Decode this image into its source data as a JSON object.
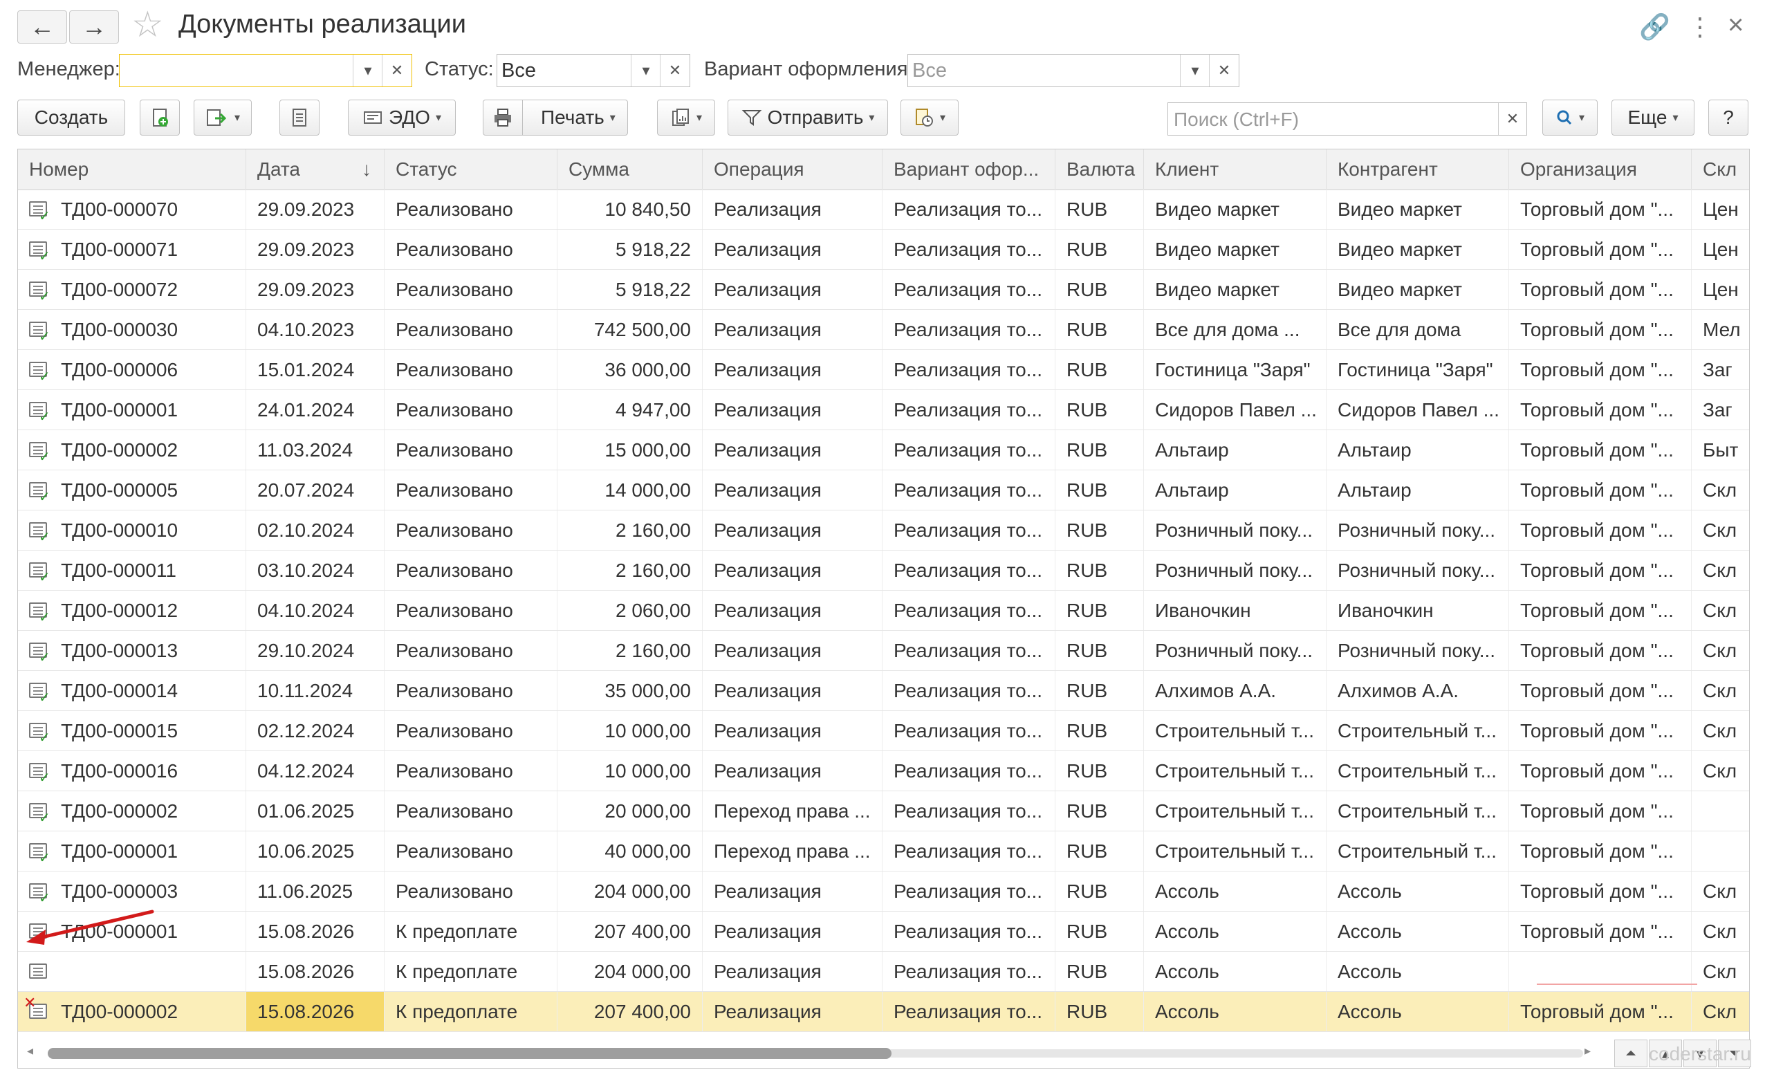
{
  "window": {
    "title": "Документы реализации",
    "back_icon": "←",
    "forward_icon": "→",
    "star_icon": "☆",
    "link_icon": "🔗",
    "menu_icon": "⋮",
    "close_icon": "×"
  },
  "filters": {
    "manager_label": "Менеджер:",
    "manager_value": "",
    "status_label": "Статус:",
    "status_value": "Все",
    "variant_label": "Вариант оформления:",
    "variant_value": "Все"
  },
  "toolbar": {
    "create": "Создать",
    "edo": "ЭДО",
    "print": "Печать",
    "send": "Отправить",
    "search_placeholder": "Поиск (Ctrl+F)",
    "more": "Еще",
    "help": "?"
  },
  "table": {
    "columns": [
      "Номер",
      "Дата",
      "Статус",
      "Сумма",
      "Операция",
      "Вариант офор...",
      "Валюта",
      "Клиент",
      "Контрагент",
      "Организация",
      "Скл"
    ],
    "sort_indicator": "↓",
    "rows": [
      {
        "icon": "posted",
        "number": "ТД00-000070",
        "date": "29.09.2023",
        "status": "Реализовано",
        "sum": "10 840,50",
        "operation": "Реализация",
        "variant": "Реализация то...",
        "currency": "RUB",
        "client": "Видео маркет",
        "counterparty": "Видео маркет",
        "org": "Торговый дом \"...",
        "wh": "Цен"
      },
      {
        "icon": "posted",
        "number": "ТД00-000071",
        "date": "29.09.2023",
        "status": "Реализовано",
        "sum": "5 918,22",
        "operation": "Реализация",
        "variant": "Реализация то...",
        "currency": "RUB",
        "client": "Видео маркет",
        "counterparty": "Видео маркет",
        "org": "Торговый дом \"...",
        "wh": "Цен"
      },
      {
        "icon": "posted",
        "number": "ТД00-000072",
        "date": "29.09.2023",
        "status": "Реализовано",
        "sum": "5 918,22",
        "operation": "Реализация",
        "variant": "Реализация то...",
        "currency": "RUB",
        "client": "Видео маркет",
        "counterparty": "Видео маркет",
        "org": "Торговый дом \"...",
        "wh": "Цен"
      },
      {
        "icon": "posted",
        "number": "ТД00-000030",
        "date": "04.10.2023",
        "status": "Реализовано",
        "sum": "742 500,00",
        "operation": "Реализация",
        "variant": "Реализация то...",
        "currency": "RUB",
        "client": "Все для дома ...",
        "counterparty": "Все для дома",
        "org": "Торговый дом \"...",
        "wh": "Мел"
      },
      {
        "icon": "posted",
        "number": "ТД00-000006",
        "date": "15.01.2024",
        "status": "Реализовано",
        "sum": "36 000,00",
        "operation": "Реализация",
        "variant": "Реализация то...",
        "currency": "RUB",
        "client": "Гостиница \"Заря\"",
        "counterparty": "Гостиница \"Заря\"",
        "org": "Торговый дом \"...",
        "wh": "Заг"
      },
      {
        "icon": "posted",
        "number": "ТД00-000001",
        "date": "24.01.2024",
        "status": "Реализовано",
        "sum": "4 947,00",
        "operation": "Реализация",
        "variant": "Реализация то...",
        "currency": "RUB",
        "client": "Сидоров Павел ...",
        "counterparty": "Сидоров Павел ...",
        "org": "Торговый дом \"...",
        "wh": "Заг"
      },
      {
        "icon": "posted",
        "number": "ТД00-000002",
        "date": "11.03.2024",
        "status": "Реализовано",
        "sum": "15 000,00",
        "operation": "Реализация",
        "variant": "Реализация то...",
        "currency": "RUB",
        "client": "Альтаир",
        "counterparty": "Альтаир",
        "org": "Торговый дом \"...",
        "wh": "Быт"
      },
      {
        "icon": "posted",
        "number": "ТД00-000005",
        "date": "20.07.2024",
        "status": "Реализовано",
        "sum": "14 000,00",
        "operation": "Реализация",
        "variant": "Реализация то...",
        "currency": "RUB",
        "client": "Альтаир",
        "counterparty": "Альтаир",
        "org": "Торговый дом \"...",
        "wh": "Скл"
      },
      {
        "icon": "posted",
        "number": "ТД00-000010",
        "date": "02.10.2024",
        "status": "Реализовано",
        "sum": "2 160,00",
        "operation": "Реализация",
        "variant": "Реализация то...",
        "currency": "RUB",
        "client": "Розничный поку...",
        "counterparty": "Розничный поку...",
        "org": "Торговый дом \"...",
        "wh": "Скл"
      },
      {
        "icon": "posted",
        "number": "ТД00-000011",
        "date": "03.10.2024",
        "status": "Реализовано",
        "sum": "2 160,00",
        "operation": "Реализация",
        "variant": "Реализация то...",
        "currency": "RUB",
        "client": "Розничный поку...",
        "counterparty": "Розничный поку...",
        "org": "Торговый дом \"...",
        "wh": "Скл"
      },
      {
        "icon": "posted",
        "number": "ТД00-000012",
        "date": "04.10.2024",
        "status": "Реализовано",
        "sum": "2 060,00",
        "operation": "Реализация",
        "variant": "Реализация то...",
        "currency": "RUB",
        "client": "Иваночкин",
        "counterparty": "Иваночкин",
        "org": "Торговый дом \"...",
        "wh": "Скл"
      },
      {
        "icon": "posted",
        "number": "ТД00-000013",
        "date": "29.10.2024",
        "status": "Реализовано",
        "sum": "2 160,00",
        "operation": "Реализация",
        "variant": "Реализация то...",
        "currency": "RUB",
        "client": "Розничный поку...",
        "counterparty": "Розничный поку...",
        "org": "Торговый дом \"...",
        "wh": "Скл"
      },
      {
        "icon": "posted",
        "number": "ТД00-000014",
        "date": "10.11.2024",
        "status": "Реализовано",
        "sum": "35 000,00",
        "operation": "Реализация",
        "variant": "Реализация то...",
        "currency": "RUB",
        "client": "Алхимов А.А.",
        "counterparty": "Алхимов А.А.",
        "org": "Торговый дом \"...",
        "wh": "Скл"
      },
      {
        "icon": "posted",
        "number": "ТД00-000015",
        "date": "02.12.2024",
        "status": "Реализовано",
        "sum": "10 000,00",
        "operation": "Реализация",
        "variant": "Реализация то...",
        "currency": "RUB",
        "client": "Строительный т...",
        "counterparty": "Строительный т...",
        "org": "Торговый дом \"...",
        "wh": "Скл"
      },
      {
        "icon": "posted",
        "number": "ТД00-000016",
        "date": "04.12.2024",
        "status": "Реализовано",
        "sum": "10 000,00",
        "operation": "Реализация",
        "variant": "Реализация то...",
        "currency": "RUB",
        "client": "Строительный т...",
        "counterparty": "Строительный т...",
        "org": "Торговый дом \"...",
        "wh": "Скл"
      },
      {
        "icon": "posted",
        "number": "ТД00-000002",
        "date": "01.06.2025",
        "status": "Реализовано",
        "sum": "20 000,00",
        "operation": "Переход права ...",
        "variant": "Реализация то...",
        "currency": "RUB",
        "client": "Строительный т...",
        "counterparty": "Строительный т...",
        "org": "Торговый дом \"...",
        "wh": ""
      },
      {
        "icon": "posted",
        "number": "ТД00-000001",
        "date": "10.06.2025",
        "status": "Реализовано",
        "sum": "40 000,00",
        "operation": "Переход права ...",
        "variant": "Реализация то...",
        "currency": "RUB",
        "client": "Строительный т...",
        "counterparty": "Строительный т...",
        "org": "Торговый дом \"...",
        "wh": ""
      },
      {
        "icon": "posted",
        "number": "ТД00-000003",
        "date": "11.06.2025",
        "status": "Реализовано",
        "sum": "204 000,00",
        "operation": "Реализация",
        "variant": "Реализация то...",
        "currency": "RUB",
        "client": "Ассоль",
        "counterparty": "Ассоль",
        "org": "Торговый дом \"...",
        "wh": "Скл"
      },
      {
        "icon": "plain",
        "number": "ТД00-000001",
        "date": "15.08.2026",
        "status": "К предоплате",
        "sum": "207 400,00",
        "operation": "Реализация",
        "variant": "Реализация то...",
        "currency": "RUB",
        "client": "Ассоль",
        "counterparty": "Ассоль",
        "org": "Торговый дом \"...",
        "wh": "Скл"
      },
      {
        "icon": "plain",
        "number": "",
        "date": "15.08.2026",
        "status": "К предоплате",
        "sum": "204 000,00",
        "operation": "Реализация",
        "variant": "Реализация то...",
        "currency": "RUB",
        "client": "Ассоль",
        "counterparty": "Ассоль",
        "org": "",
        "wh": "Скл"
      },
      {
        "icon": "deleted",
        "number": "ТД00-000002",
        "date": "15.08.2026",
        "status": "К предоплате",
        "sum": "207 400,00",
        "operation": "Реализация",
        "variant": "Реализация то...",
        "currency": "RUB",
        "client": "Ассоль",
        "counterparty": "Ассоль",
        "org": "Торговый дом \"...",
        "wh": "Скл"
      }
    ]
  },
  "watermark": "coderstar.ru",
  "colors": {
    "selected_row": "#fbeeb9",
    "selected_cell": "#f6d96a",
    "posted_check": "#2e9c2e",
    "deletion_mark": "#d21a1a",
    "annotation_arrow": "#d21a1a"
  }
}
